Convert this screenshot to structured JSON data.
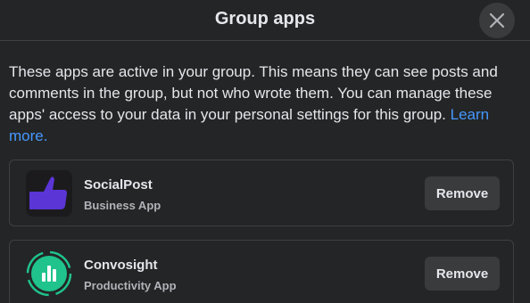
{
  "dialog": {
    "title": "Group apps",
    "close_icon": "close-icon"
  },
  "description": {
    "text": "These apps are active in your group. This means they can see posts and comments in the group, but not who wrote them. You can manage these apps' access to your data in your personal settings for this group. ",
    "link_text": "Learn more."
  },
  "apps": [
    {
      "name": "SocialPost",
      "type": "Business App",
      "icon": "socialpost-logo-icon",
      "remove_label": "Remove"
    },
    {
      "name": "Convosight",
      "type": "Productivity App",
      "icon": "convosight-logo-icon",
      "remove_label": "Remove"
    }
  ],
  "colors": {
    "background": "#242526",
    "button": "#3a3b3c",
    "link": "#4599ff",
    "socialpost_purple": "#5b35d5",
    "convosight_green": "#1fc38b"
  }
}
